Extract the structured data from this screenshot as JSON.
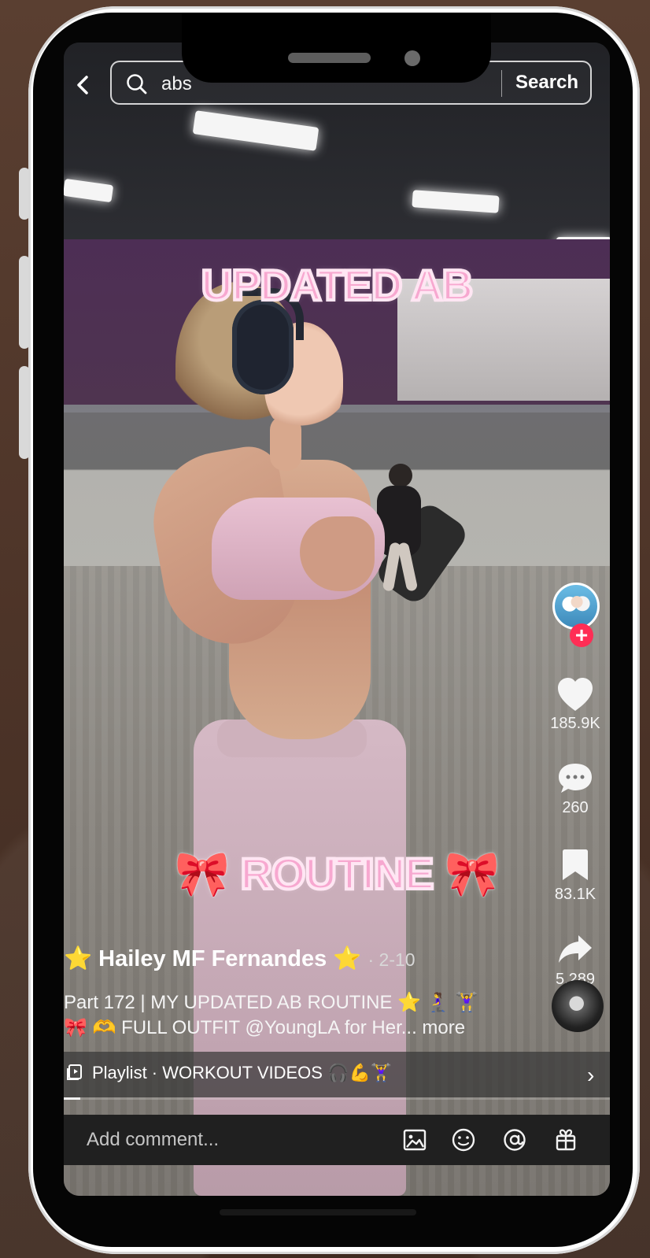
{
  "app": {
    "search": {
      "value": "abs",
      "button_label": "Search"
    },
    "overlay": {
      "top_text": "UPDATED AB",
      "bottom_text": "🎀 ROUTINE 🎀"
    },
    "actions": {
      "likes": "185.9K",
      "comments": "260",
      "bookmarks": "83.1K",
      "shares": "5,289"
    },
    "post": {
      "creator": "⭐ Hailey MF Fernandes ⭐",
      "date": "· 2-10",
      "caption_line_1": "Part 172 | MY UPDATED AB ROUTINE ⭐ 🧎‍♀️ 🏋️‍♀️",
      "caption_line_2": "🎀 🫶 FULL OUTFIT @YoungLA for Her...",
      "more": "more"
    },
    "playlist": {
      "label": "Playlist · WORKOUT VIDEOS 🎧💪🏋️‍♀️"
    },
    "comment": {
      "placeholder": "Add comment..."
    },
    "progress": 0.03,
    "icons": {
      "back": "back-icon",
      "search": "search-icon",
      "heart": "heart-icon",
      "comment": "comment-icon",
      "bookmark": "bookmark-icon",
      "share": "share-icon",
      "image": "image-icon",
      "emoji": "emoji-icon",
      "mention": "at-icon",
      "gift": "gift-icon",
      "playlist": "playlist-icon"
    },
    "colors": {
      "overlay_text": "#f7a8d0",
      "follow_plus": "#ff2d55",
      "app_background": "#202020"
    }
  }
}
